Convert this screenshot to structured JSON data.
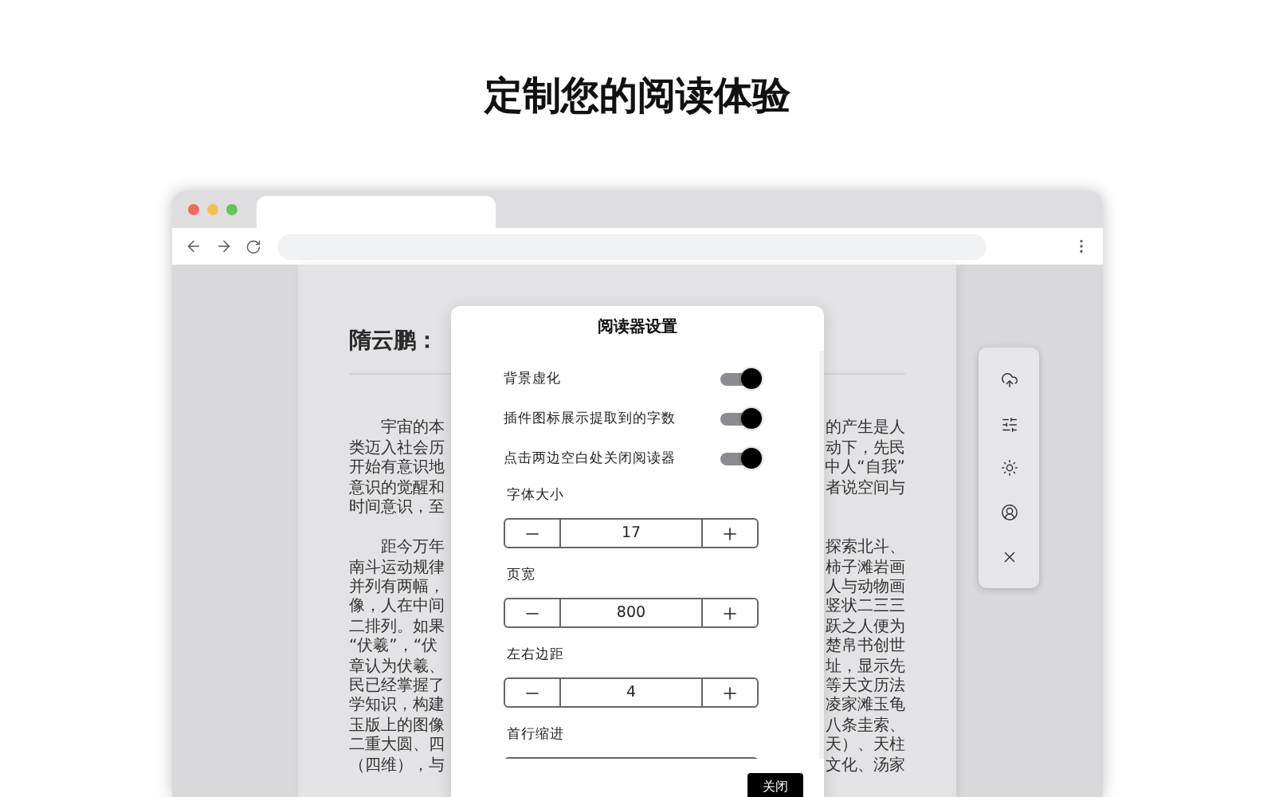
{
  "heading": "定制您的阅读体验",
  "article": {
    "title": "隋云鹏：",
    "paragraphs": [
      [
        {
          "left": "宇宙的本",
          "right": "的产生是人"
        },
        {
          "left": "类迈入社会历",
          "right": "动下，先民"
        },
        {
          "left": "开始有意识地",
          "right": "中人“自我”"
        },
        {
          "left": "意识的觉醒和",
          "right": "者说空间与"
        },
        {
          "left": "时间意识，至"
        }
      ],
      [
        {
          "left": "距今万年",
          "right": "探索北斗、"
        },
        {
          "left": "南斗运动规律",
          "right": "柿子滩岩画"
        },
        {
          "left": "并列有两幅，",
          "right": "人与动物画"
        },
        {
          "left": "像，人在中间",
          "right": "竖状二三三"
        },
        {
          "left": "二排列。如果",
          "right": "跃之人便为"
        },
        {
          "left": "“伏羲”，“伏",
          "right": "楚帛书创世"
        },
        {
          "left": "章认为伏羲、",
          "right": "址，显示先"
        },
        {
          "left": "民已经掌握了",
          "right": "等天文历法"
        },
        {
          "left": "学知识，构建",
          "right": "凌家滩玉龟"
        },
        {
          "left": "玉版上的图像",
          "right": "八条圭索、"
        },
        {
          "left": "二重大圆、四",
          "right": "天）、天柱"
        },
        {
          "left": "（四维），与",
          "right": "文化、汤家"
        }
      ]
    ]
  },
  "dialog": {
    "title": "阅读器设置",
    "toggles": [
      {
        "label": "背景虚化",
        "on": true
      },
      {
        "label": "插件图标展示提取到的字数",
        "on": true
      },
      {
        "label": "点击两边空白处关闭阅读器",
        "on": true
      }
    ],
    "steppers": [
      {
        "label": "字体大小",
        "value": "17"
      },
      {
        "label": "页宽",
        "value": "800"
      },
      {
        "label": "左右边距",
        "value": "4"
      },
      {
        "label": "首行缩进"
      }
    ],
    "close_button": "关闭"
  }
}
